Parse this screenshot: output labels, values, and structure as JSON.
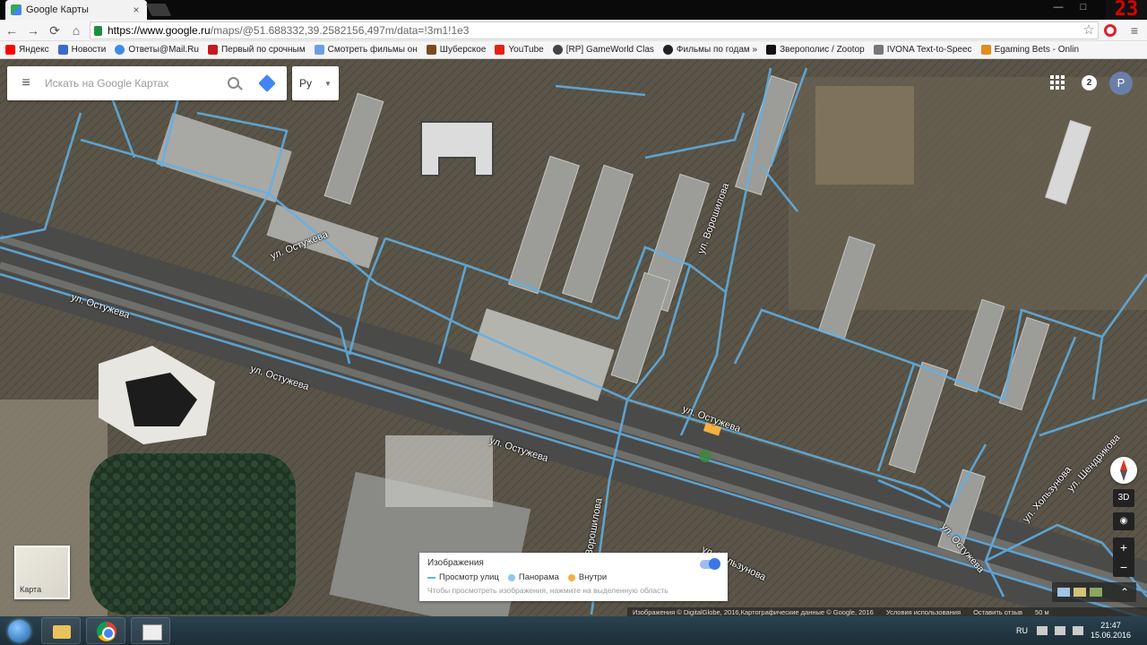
{
  "browser": {
    "tab_title": "Google Карты",
    "tab_close": "×",
    "window_controls": [
      "—",
      "□"
    ],
    "overlay_counter": "23",
    "url_host": "https://www.google.ru",
    "url_rest": "/maps/@51.688332,39.2582156,497m/data=!3m1!1e3",
    "back": "←",
    "forward": "→",
    "reload": "⟳",
    "home": "⌂",
    "star": "☆",
    "menu": "≡"
  },
  "bookmarks": [
    {
      "label": "Яндекс",
      "color": "#ff0000"
    },
    {
      "label": "Новости",
      "color": "#3b6cc7"
    },
    {
      "label": "Ответы@Mail.Ru",
      "color": "#3a8ee6"
    },
    {
      "label": "Первый по срочным",
      "color": "#c21b1b"
    },
    {
      "label": "Смотреть фильмы он",
      "color": "#6ba0e0"
    },
    {
      "label": "Шуберское",
      "color": "#7a4a1d"
    },
    {
      "label": "YouTube",
      "color": "#e62117"
    },
    {
      "label": "[RP] GameWorld Clas",
      "color": "#444444"
    },
    {
      "label": "Фильмы по годам » ",
      "color": "#222222"
    },
    {
      "label": "Зверополис / Zootop",
      "color": "#111111"
    },
    {
      "label": "IVONA Text-to-Speec",
      "color": "#777777"
    },
    {
      "label": "Egaming Bets - Onlin",
      "color": "#e28b1c"
    }
  ],
  "search": {
    "placeholder": "Искать на Google Картах",
    "menu_icon": "≡"
  },
  "language": {
    "value": "Ру",
    "caret": "▼"
  },
  "account": {
    "notifications": "2",
    "avatar_letter": "P"
  },
  "street_labels": [
    "ул. Остужева",
    "ул. Остужева",
    "ул. Остужева",
    "ул. Остужева",
    "ул. Остужева",
    "ул. Остужева",
    "ул. Ворошилова",
    "ул. Ворошилова",
    "ул. Хользунова",
    "ул. Хользунова",
    "ул. Шендрикова"
  ],
  "minimap_label": "Карта",
  "layers_panel": {
    "title": "Изображения",
    "toggle_on": true,
    "legend": [
      {
        "label": "Просмотр улиц",
        "color": "#61b1e6",
        "shape": "line"
      },
      {
        "label": "Панорама",
        "color": "#8fc7f0",
        "shape": "dot"
      },
      {
        "label": "Внутри",
        "color": "#f5b041",
        "shape": "dot"
      }
    ],
    "hint": "Чтобы просмотреть изображения, нажмите на выделенную область"
  },
  "controls": {
    "tilt_label": "3D",
    "zoom_in": "+",
    "zoom_out": "−"
  },
  "attribution": {
    "imagery": "Изображения © DigitalGlobe, 2016,Картографические данные © Google, 2016",
    "terms": "Условия использования",
    "feedback": "Оставить отзыв",
    "scale": "50 м"
  },
  "taskbar": {
    "lang": "RU",
    "time": "21:47",
    "date": "15.06.2016"
  },
  "colors": {
    "street_view_line": "#61b1e6",
    "accent": "#4285f4"
  }
}
